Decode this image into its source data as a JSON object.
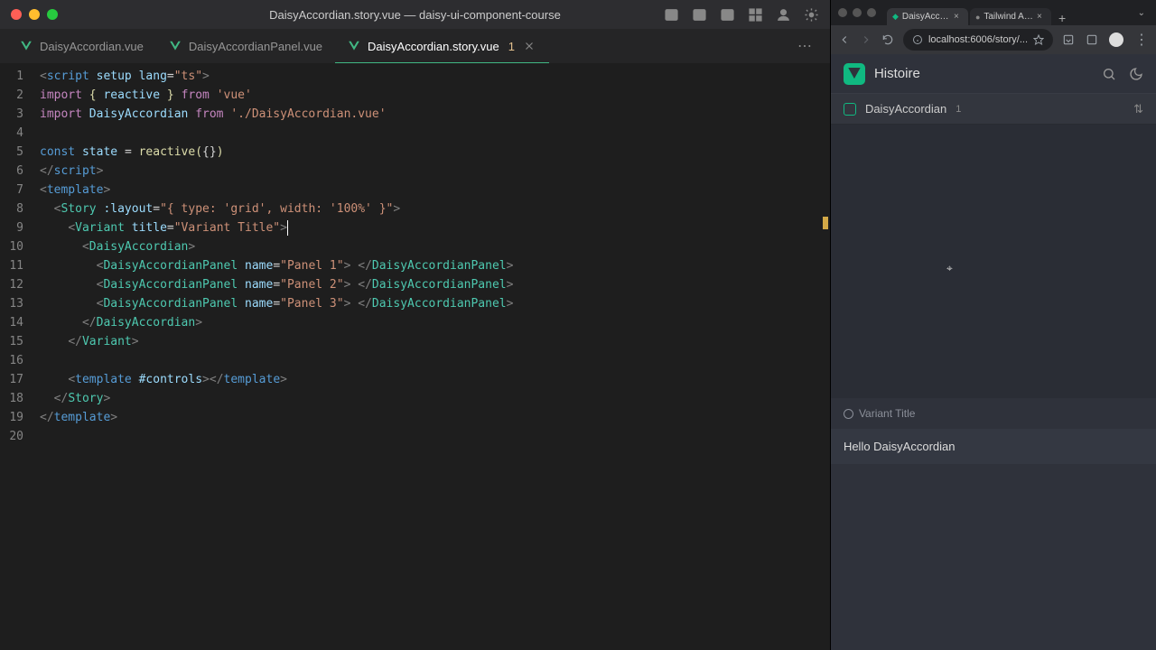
{
  "vscode": {
    "title": "DaisyAccordian.story.vue — daisy-ui-component-course",
    "tabs": [
      {
        "label": "DaisyAccordian.vue",
        "active": false,
        "modified": false
      },
      {
        "label": "DaisyAccordianPanel.vue",
        "active": false,
        "modified": false
      },
      {
        "label": "DaisyAccordian.story.vue",
        "active": true,
        "modified": true,
        "mod_indicator": "1"
      }
    ]
  },
  "code": {
    "lines": [
      "1",
      "2",
      "3",
      "4",
      "5",
      "6",
      "7",
      "8",
      "9",
      "10",
      "11",
      "12",
      "13",
      "14",
      "15",
      "16",
      "17",
      "18",
      "19",
      "20"
    ]
  },
  "browser": {
    "tabs": [
      {
        "label": "DaisyAccordian"
      },
      {
        "label": "Tailwind Accor"
      }
    ],
    "url": "localhost:6006/story/..."
  },
  "histoire": {
    "title": "Histoire",
    "story_name": "DaisyAccordian",
    "story_badge": "1",
    "variant_title": "Variant Title",
    "variant_content": "Hello DaisyAccordian"
  }
}
